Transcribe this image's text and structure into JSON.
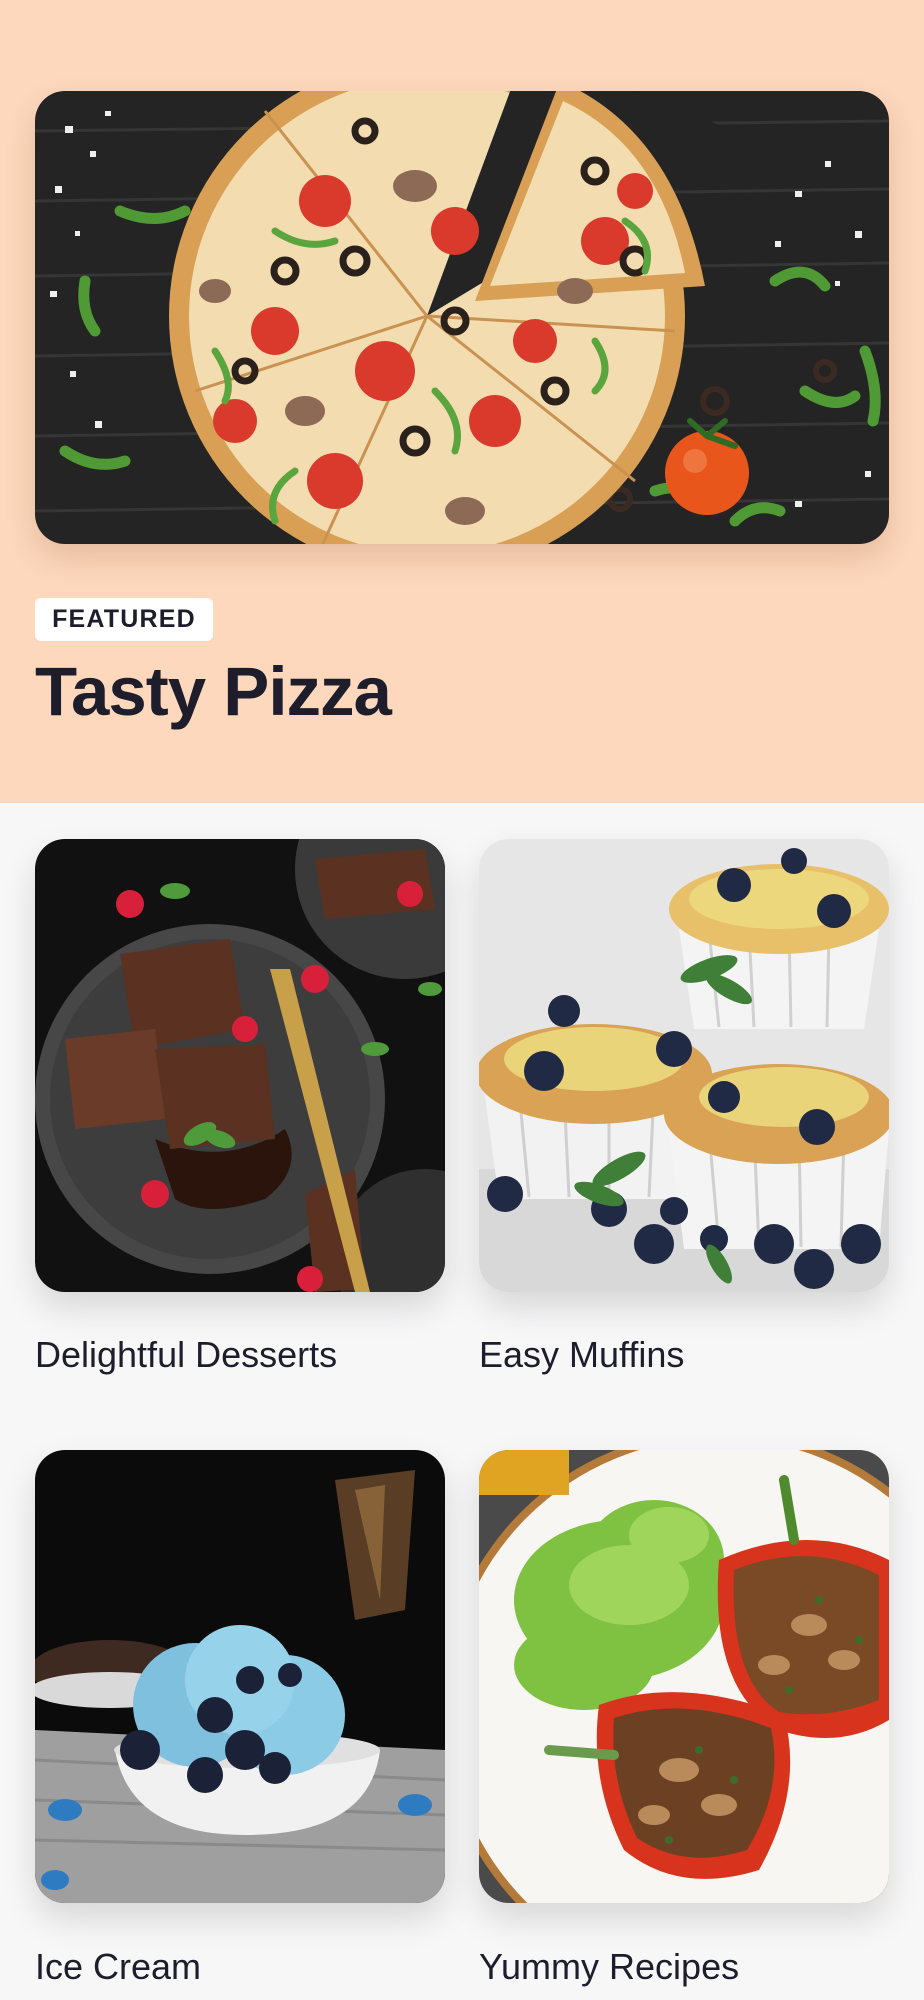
{
  "featured": {
    "badge": "FEATURED",
    "title": "Tasty Pizza",
    "image": "pizza-photo"
  },
  "recipes": [
    {
      "label": "Delightful Desserts",
      "image": "chocolate-brownies-photo"
    },
    {
      "label": "Easy Muffins",
      "image": "blueberry-muffins-photo"
    },
    {
      "label": "Ice Cream",
      "image": "blue-ice-cream-photo"
    },
    {
      "label": "Yummy Recipes",
      "image": "stuffed-peppers-photo"
    }
  ],
  "colors": {
    "featured_bg": "#fdd8bd",
    "page_bg": "#f7f7f8",
    "text": "#1d1d2b",
    "badge_bg": "#ffffff"
  }
}
